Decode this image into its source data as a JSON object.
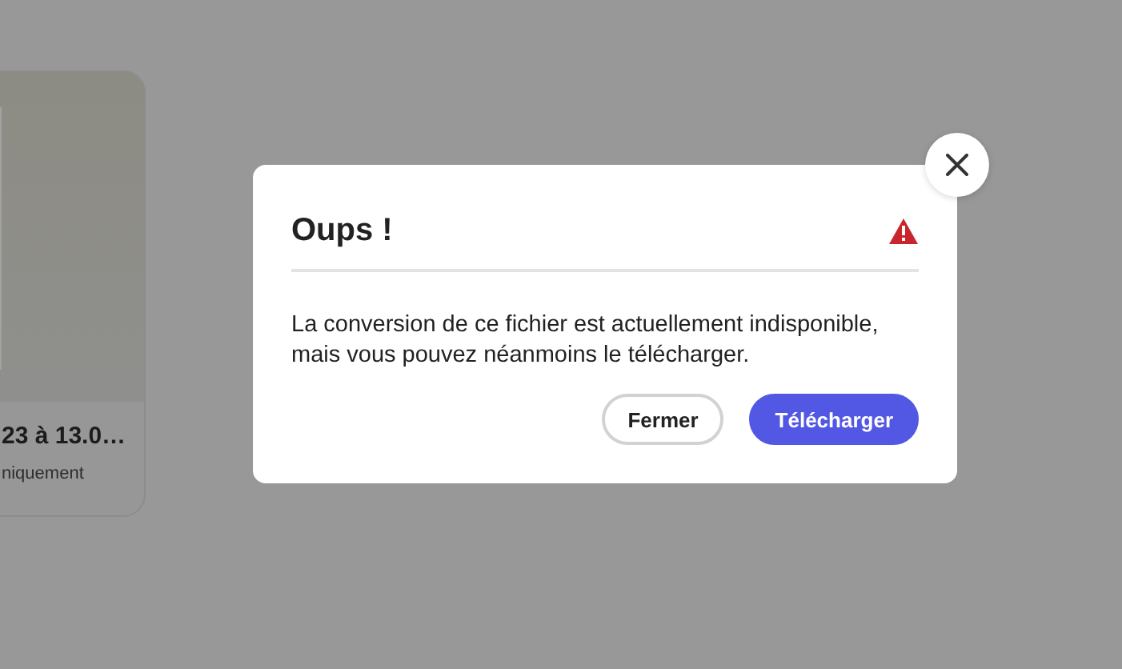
{
  "background_card": {
    "title": "23 à 13.0…",
    "subtitle": "niquement"
  },
  "dialog": {
    "title": "Oups !",
    "message": "La conversion de ce fichier est actuellement indisponible, mais vous pouvez néanmoins le télécharger.",
    "buttons": [
      {
        "label": "Fermer",
        "kind": "secondary"
      },
      {
        "label": "Télécharger",
        "kind": "primary"
      }
    ]
  }
}
